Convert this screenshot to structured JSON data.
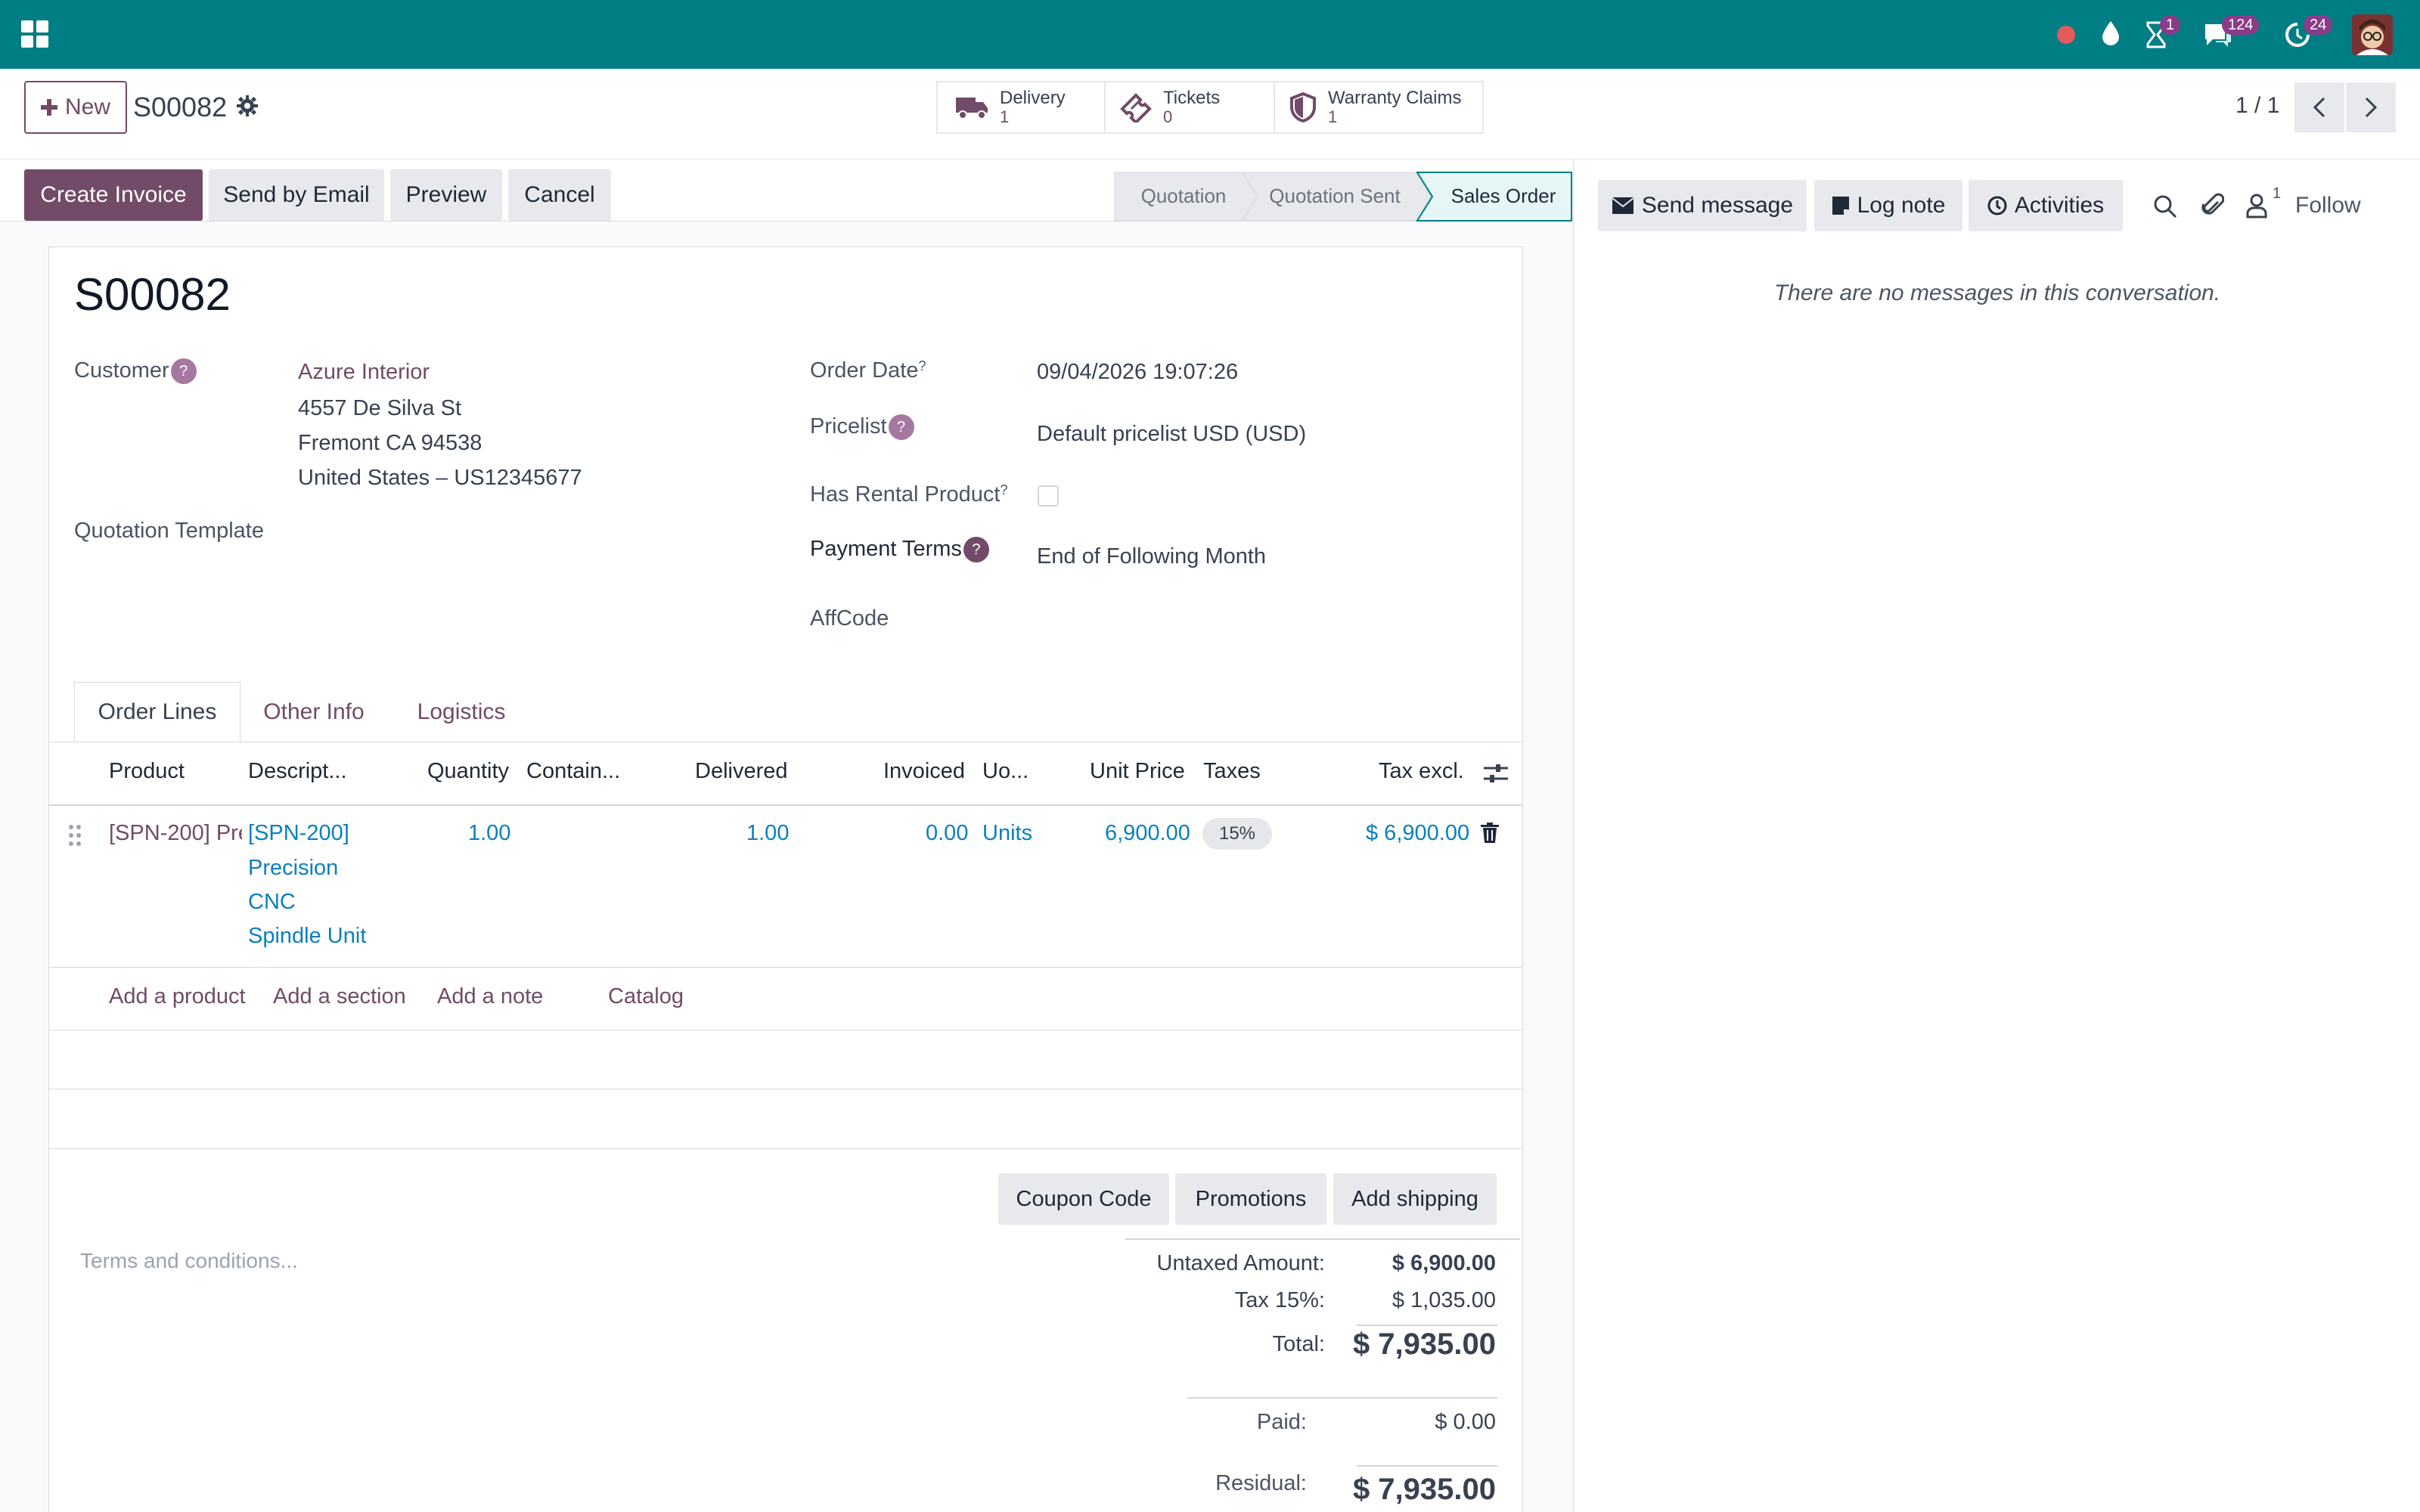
{
  "navbar": {
    "bg": "#017e84",
    "badges": {
      "activities": "1",
      "messages": "124",
      "updates": "24"
    }
  },
  "control_panel": {
    "new_label": "New",
    "record_name": "S00082",
    "smart_buttons": [
      {
        "label": "Delivery",
        "value": "1",
        "icon": "truck-icon"
      },
      {
        "label": "Tickets",
        "value": "0",
        "icon": "ticket-icon"
      },
      {
        "label": "Warranty Claims",
        "value": "1",
        "icon": "shield-icon"
      }
    ],
    "pager": "1 / 1"
  },
  "actions": {
    "create_invoice": "Create Invoice",
    "send_by_email": "Send by Email",
    "preview": "Preview",
    "cancel": "Cancel"
  },
  "status": {
    "stages": [
      "Quotation",
      "Quotation Sent",
      "Sales Order"
    ],
    "current": "Sales Order"
  },
  "chatter": {
    "send_message": "Send message",
    "log_note": "Log note",
    "activities": "Activities",
    "followers_count": "1",
    "follow": "Follow",
    "empty": "There are no messages in this conversation."
  },
  "form": {
    "title": "S00082",
    "customer_label": "Customer",
    "customer_name": "Azure Interior",
    "address_1": "4557 De Silva St",
    "address_2": "Fremont CA 94538",
    "address_3": "United States – US12345677",
    "quotation_template_label": "Quotation Template",
    "order_date_label": "Order Date",
    "order_date": "09/04/2026 19:07:26",
    "pricelist_label": "Pricelist",
    "pricelist": "Default pricelist USD (USD)",
    "rental_label": "Has Rental Product",
    "payment_terms_label": "Payment Terms",
    "payment_terms": "End of Following Month",
    "affcode_label": "AffCode"
  },
  "tabs": [
    "Order Lines",
    "Other Info",
    "Logistics"
  ],
  "table": {
    "headers": [
      "Product",
      "Descript...",
      "Quantity",
      "Contain...",
      "Delivered",
      "Invoiced",
      "Uo...",
      "Unit Price",
      "Taxes",
      "Tax excl."
    ],
    "row": {
      "product": "[SPN-200] Pre",
      "description": [
        "[SPN-200]",
        "Precision",
        "CNC",
        "Spindle Unit"
      ],
      "quantity": "1.00",
      "delivered": "1.00",
      "invoiced": "0.00",
      "uom": "Units",
      "unit_price": "6,900.00",
      "tax": "15%",
      "subtotal": "$ 6,900.00"
    },
    "add_product": "Add a product",
    "add_section": "Add a section",
    "add_note": "Add a note",
    "catalog": "Catalog"
  },
  "footer": {
    "coupon": "Coupon Code",
    "promotions": "Promotions",
    "add_shipping": "Add shipping",
    "terms_placeholder": "Terms and conditions...",
    "untaxed_label": "Untaxed Amount:",
    "untaxed": "$ 6,900.00",
    "tax_label": "Tax 15%:",
    "tax": "$ 1,035.00",
    "total_label": "Total:",
    "total": "$ 7,935.00",
    "paid_label": "Paid:",
    "paid": "$ 0.00",
    "residual_label": "Residual:",
    "residual": "$ 7,935.00"
  }
}
